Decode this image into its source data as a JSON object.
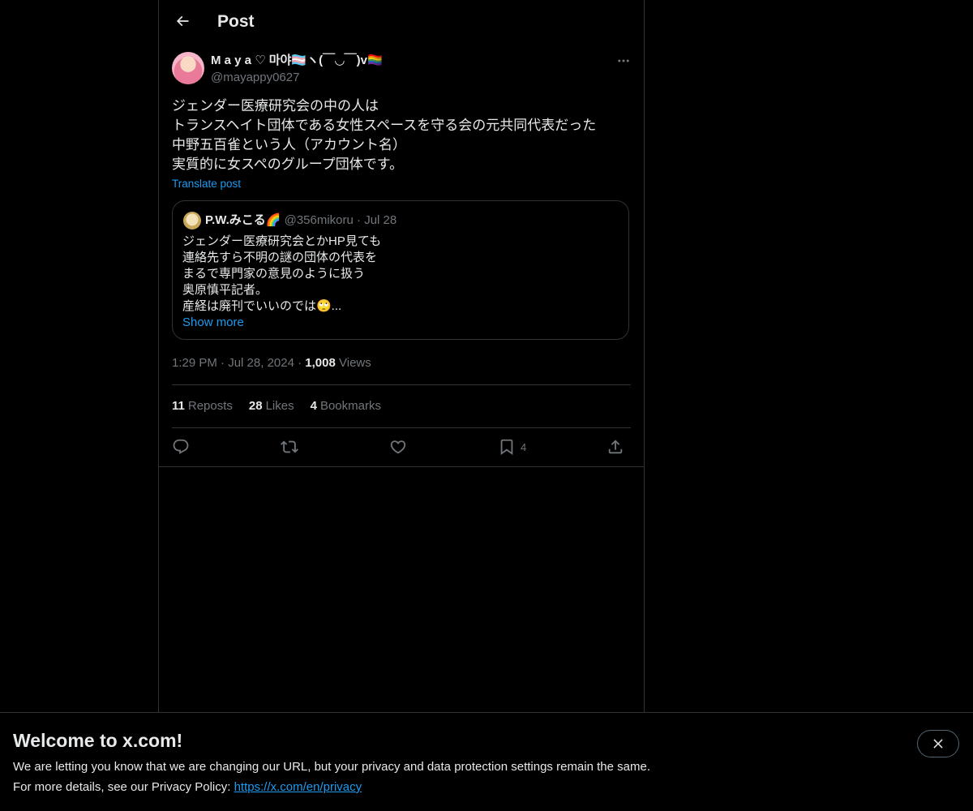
{
  "header": {
    "title": "Post"
  },
  "post": {
    "author_name": "M a y a ♡ 마야🏳️‍⚧️ヽ(￣◡￣)v🏳️‍🌈",
    "author_handle": "@mayappy0627",
    "text": "ジェンダー医療研究会の中の人は\nトランスヘイト団体である女性スペースを守る会の元共同代表だった\n中野五百雀という人（アカウント名）\n実質的に女スペのグループ団体です。",
    "translate_label": "Translate post",
    "time": "1:29 PM",
    "date": "Jul 28, 2024",
    "views_count": "1,008",
    "views_label": "Views"
  },
  "quote": {
    "author_name": "P.W.みこる🌈",
    "author_handle": "@356mikoru",
    "date": "Jul 28",
    "text": "ジェンダー医療研究会とかHP見ても\n連絡先すら不明の謎の団体の代表を\nまるで専門家の意見のように扱う\n奥原慎平記者。\n産経は廃刊でいいのでは🙄...",
    "show_more": "Show more"
  },
  "stats": {
    "reposts_count": "11",
    "reposts_label": "Reposts",
    "likes_count": "28",
    "likes_label": "Likes",
    "bookmarks_count": "4",
    "bookmarks_label": "Bookmarks"
  },
  "actions": {
    "bookmark_count": "4",
    "icons": [
      "reply-icon",
      "repost-icon",
      "like-icon",
      "bookmark-icon",
      "share-icon"
    ]
  },
  "banner": {
    "title": "Welcome to x.com!",
    "line1": "We are letting you know that we are changing our URL, but your privacy and data protection settings remain the same.",
    "line2_prefix": "For more details, see our Privacy Policy: ",
    "link_text": "https://x.com/en/privacy"
  },
  "colors": {
    "background": "#000000",
    "text": "#e7e9ea",
    "muted": "#71767b",
    "accent": "#1d9bf0",
    "border": "#2f3336"
  }
}
